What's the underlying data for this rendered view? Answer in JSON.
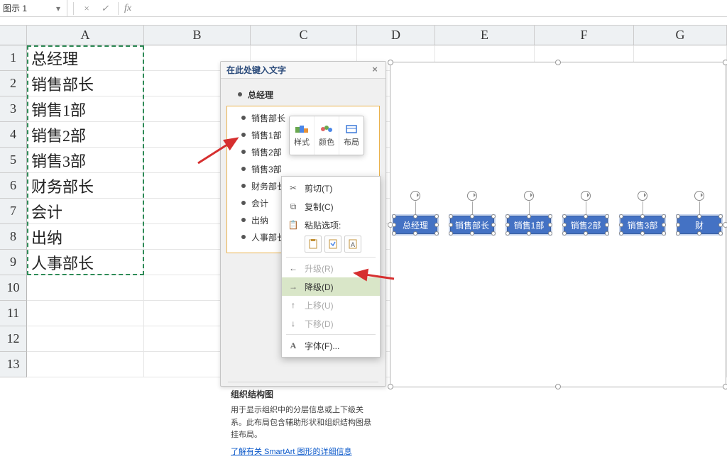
{
  "formula_bar": {
    "name_box": "图示 1",
    "cancel_icon": "×",
    "confirm_icon": "✓",
    "fx_label": "fx"
  },
  "columns": [
    "A",
    "B",
    "C",
    "D",
    "E",
    "F",
    "G"
  ],
  "rows": [
    {
      "n": "1",
      "A": "总经理"
    },
    {
      "n": "2",
      "A": "销售部长"
    },
    {
      "n": "3",
      "A": "销售1部"
    },
    {
      "n": "4",
      "A": "销售2部"
    },
    {
      "n": "5",
      "A": "销售3部"
    },
    {
      "n": "6",
      "A": "财务部长"
    },
    {
      "n": "7",
      "A": "会计"
    },
    {
      "n": "8",
      "A": "出纳"
    },
    {
      "n": "9",
      "A": "人事部长"
    },
    {
      "n": "10",
      "A": ""
    },
    {
      "n": "11",
      "A": ""
    },
    {
      "n": "12",
      "A": ""
    },
    {
      "n": "13",
      "A": ""
    }
  ],
  "smartart_pane": {
    "title": "在此处键入文字",
    "root": "总经理",
    "items": [
      "销售部长",
      "销售1部",
      "销售2部",
      "销售3部",
      "财务部长",
      "会计",
      "出纳",
      "人事部长"
    ],
    "desc_title": "组织结构图",
    "desc_body": "用于显示组织中的分层信息或上下级关系。此布局包含辅助形状和组织结构图悬挂布局。",
    "desc_link": "了解有关 SmartArt 图形的详细信息"
  },
  "mini_toolbar": {
    "style": "样式",
    "color": "颜色",
    "layout": "布局"
  },
  "context_menu": {
    "cut": "剪切(T)",
    "copy": "复制(C)",
    "paste_label": "粘贴选项:",
    "promote": "升级(R)",
    "demote": "降级(D)",
    "move_up": "上移(U)",
    "move_down": "下移(D)",
    "font": "字体(F)..."
  },
  "smartart_nodes": [
    "总经理",
    "销售部长",
    "销售1部",
    "销售2部",
    "销售3部",
    "财"
  ]
}
